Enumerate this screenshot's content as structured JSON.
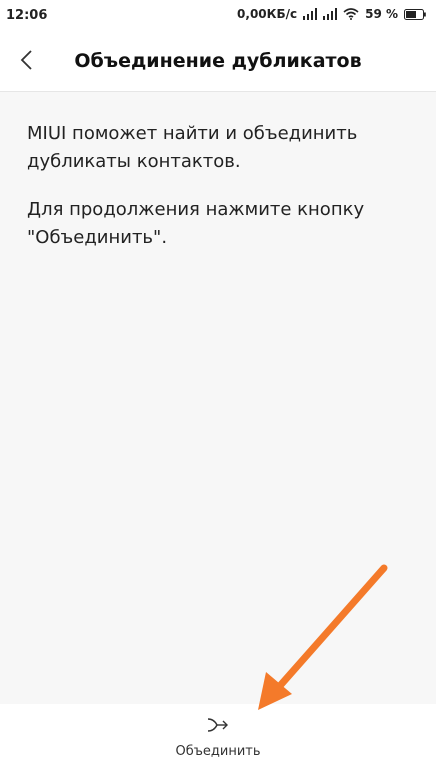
{
  "status_bar": {
    "time": "12:06",
    "network_speed": "0,00КБ/с",
    "battery": "59 %",
    "icons": [
      "signal-icon",
      "signal-icon",
      "wifi-icon",
      "battery-icon"
    ]
  },
  "header": {
    "title": "Объединение дубликатов",
    "back_icon": "chevron-left-icon"
  },
  "content": {
    "paragraph1": "MIUI поможет найти и объединить дубликаты контактов.",
    "paragraph2": "Для продолжения нажмите кнопку \"Объединить\"."
  },
  "bottom_bar": {
    "merge_label": "Объединить",
    "merge_icon": "merge-arrow-icon"
  },
  "annotation": {
    "arrow_color": "#f47a2a"
  }
}
